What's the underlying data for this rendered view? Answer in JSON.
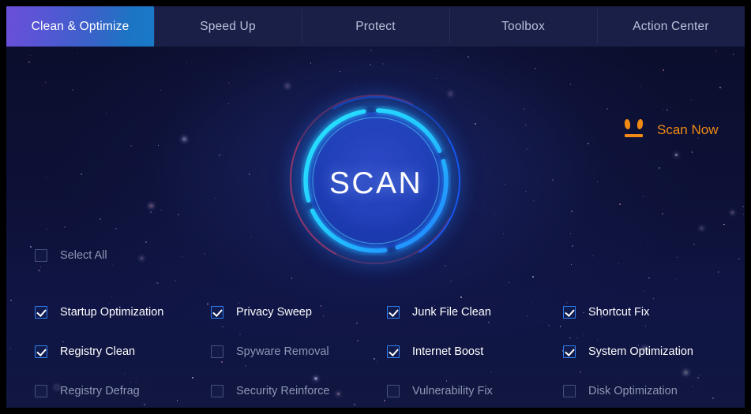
{
  "app": {
    "background_color": "#0d1033",
    "accent_color": "#2f7ff0",
    "scan_button_color": "#f08a15"
  },
  "tabs": [
    {
      "label": "Clean & Optimize",
      "active": true
    },
    {
      "label": "Speed Up",
      "active": false
    },
    {
      "label": "Protect",
      "active": false
    },
    {
      "label": "Toolbox",
      "active": false
    },
    {
      "label": "Action Center",
      "active": false
    }
  ],
  "scan_now": {
    "label": "Scan Now",
    "icon": "footprints-icon"
  },
  "scan_button": {
    "label": "SCAN"
  },
  "select_all": {
    "label": "Select All",
    "checked": false
  },
  "options": [
    {
      "label": "Startup Optimization",
      "checked": true
    },
    {
      "label": "Privacy Sweep",
      "checked": true
    },
    {
      "label": "Junk File Clean",
      "checked": true
    },
    {
      "label": "Shortcut Fix",
      "checked": true
    },
    {
      "label": "Registry Clean",
      "checked": true
    },
    {
      "label": "Spyware Removal",
      "checked": false
    },
    {
      "label": "Internet Boost",
      "checked": true
    },
    {
      "label": "System Optimization",
      "checked": true
    },
    {
      "label": "Registry Defrag",
      "checked": false
    },
    {
      "label": "Security Reinforce",
      "checked": false
    },
    {
      "label": "Vulnerability Fix",
      "checked": false
    },
    {
      "label": "Disk Optimization",
      "checked": false
    }
  ]
}
